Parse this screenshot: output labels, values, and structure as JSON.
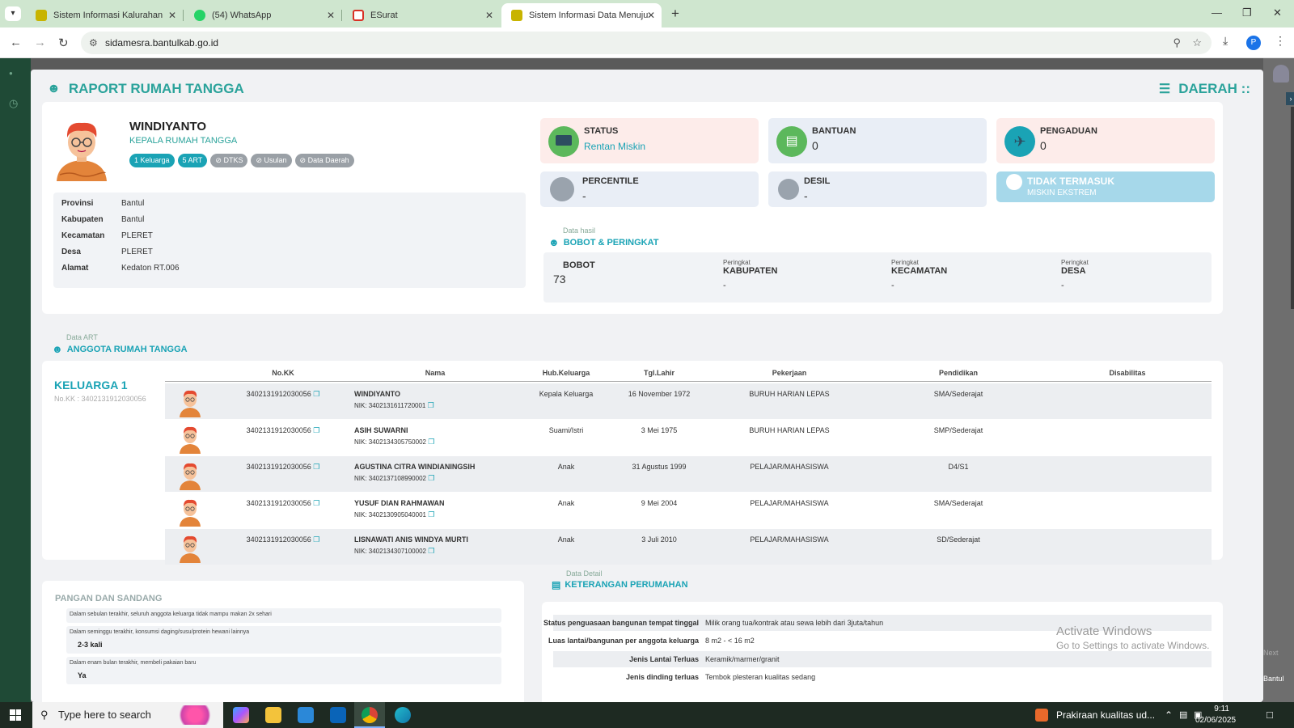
{
  "browser": {
    "tabs": [
      {
        "title": "Sistem Informasi Kalurahan Ple",
        "favicon_color": "#c8b400"
      },
      {
        "title": "(54) WhatsApp",
        "favicon_color": "#25d366"
      },
      {
        "title": "ESurat",
        "favicon_color": "#d93025"
      },
      {
        "title": "Sistem Informasi Data Menuju S",
        "favicon_color": "#c8b400"
      }
    ],
    "url": "sidamesra.bantulkab.go.id",
    "profile_initial": "P"
  },
  "modal": {
    "title": "RAPORT RUMAH TANGGA",
    "region_title": "DAERAH ::",
    "person": {
      "name": "WINDIYANTO",
      "role": "KEPALA RUMAH TANGGA",
      "badges": [
        "1 Keluarga",
        "5 ART",
        "DTKS",
        "Usulan",
        "Data Daerah"
      ]
    },
    "address": [
      {
        "key": "Provinsi",
        "value": "Bantul"
      },
      {
        "key": "Kabupaten",
        "value": "Bantul"
      },
      {
        "key": "Kecamatan",
        "value": "PLERET"
      },
      {
        "key": "Desa",
        "value": "PLERET"
      },
      {
        "key": "Alamat",
        "value": "Kedaton RT.006"
      }
    ],
    "status_cards": {
      "status": {
        "label": "STATUS",
        "value": "Rentan Miskin"
      },
      "bantuan": {
        "label": "BANTUAN",
        "value": "0"
      },
      "pengaduan": {
        "label": "PENGADUAN",
        "value": "0"
      },
      "percentile": {
        "label": "PERCENTILE",
        "value": "-"
      },
      "desil": {
        "label": "DESIL",
        "value": "-"
      },
      "ekstrem": {
        "label": "TIDAK TERMASUK",
        "value": "MISKIN EKSTREM"
      }
    },
    "bobot": {
      "section_small": "Data hasil",
      "section_title": "BOBOT & PERINGKAT",
      "bobot_label": "BOBOT",
      "bobot_value": "73",
      "peringkat_small": "Peringkat",
      "kabupaten": {
        "label": "KABUPATEN",
        "value": "-"
      },
      "kecamatan": {
        "label": "KECAMATAN",
        "value": "-"
      },
      "desa": {
        "label": "DESA",
        "value": "-"
      }
    },
    "art": {
      "section_small": "Data ART",
      "section_title": "ANGGOTA RUMAH TANGGA",
      "family_title": "KELUARGA 1",
      "family_nokk": "No.KK : 3402131912030056",
      "columns": [
        "No.KK",
        "Nama",
        "Hub.Keluarga",
        "Tgl.Lahir",
        "Pekerjaan",
        "Pendidikan",
        "Disabilitas"
      ],
      "rows": [
        {
          "nokk": "3402131912030056",
          "nama": "WINDIYANTO",
          "nik": "NIK: 3402131611720001",
          "hub": "Kepala Keluarga",
          "lahir": "16 November 1972",
          "kerja": "BURUH HARIAN LEPAS",
          "didik": "SMA/Sederajat",
          "dis": ""
        },
        {
          "nokk": "3402131912030056",
          "nama": "ASIH SUWARNI",
          "nik": "NIK: 3402134305750002",
          "hub": "Suami/Istri",
          "lahir": "3 Mei 1975",
          "kerja": "BURUH HARIAN LEPAS",
          "didik": "SMP/Sederajat",
          "dis": ""
        },
        {
          "nokk": "3402131912030056",
          "nama": "AGUSTINA CITRA WINDIANINGSIH",
          "nik": "NIK: 3402137108990002",
          "hub": "Anak",
          "lahir": "31 Agustus 1999",
          "kerja": "PELAJAR/MAHASISWA",
          "didik": "D4/S1",
          "dis": ""
        },
        {
          "nokk": "3402131912030056",
          "nama": "YUSUF DIAN RAHMAWAN",
          "nik": "NIK: 3402130905040001",
          "hub": "Anak",
          "lahir": "9 Mei 2004",
          "kerja": "PELAJAR/MAHASISWA",
          "didik": "SMA/Sederajat",
          "dis": ""
        },
        {
          "nokk": "3402131912030056",
          "nama": "LISNAWATI ANIS WINDYA MURTI",
          "nik": "NIK: 3402134307100002",
          "hub": "Anak",
          "lahir": "3 Juli 2010",
          "kerja": "PELAJAR/MAHASISWA",
          "didik": "SD/Sederajat",
          "dis": ""
        }
      ]
    },
    "pangan": {
      "title": "PANGAN DAN SANDANG",
      "items": [
        {
          "q": "Dalam sebulan terakhir, seluruh anggota keluarga tidak mampu makan 2x sehari",
          "a": ""
        },
        {
          "q": "Dalam seminggu terakhir, konsumsi daging/susu/protein hewani lainnya",
          "a": "2-3 kali"
        },
        {
          "q": "Dalam enam bulan terakhir, membeli pakaian baru",
          "a": "Ya"
        }
      ]
    },
    "perumahan": {
      "section_small": "Data Detail",
      "section_title": "KETERANGAN PERUMAHAN",
      "rows": [
        {
          "k": "Status penguasaan bangunan tempat tinggal",
          "v": "Milik orang tua/kontrak atau sewa lebih dari 3juta/tahun"
        },
        {
          "k": "Luas lantai/bangunan per anggota keluarga",
          "v": "8 m2 - < 16 m2"
        },
        {
          "k": "Jenis Lantai Terluas",
          "v": "Keramik/marmer/granit"
        },
        {
          "k": "Jenis dinding terluas",
          "v": "Tembok plesteran kualitas sedang"
        }
      ]
    }
  },
  "watermark": {
    "line1": "Activate Windows",
    "line2": "Go to Settings to activate Windows."
  },
  "taskbar": {
    "search_placeholder": "Type here to search",
    "weather": "Prakiraan kualitas ud...",
    "time": "9:11",
    "date": "02/06/2025"
  },
  "side": {
    "next": "Next",
    "bantul": "Bantul"
  }
}
